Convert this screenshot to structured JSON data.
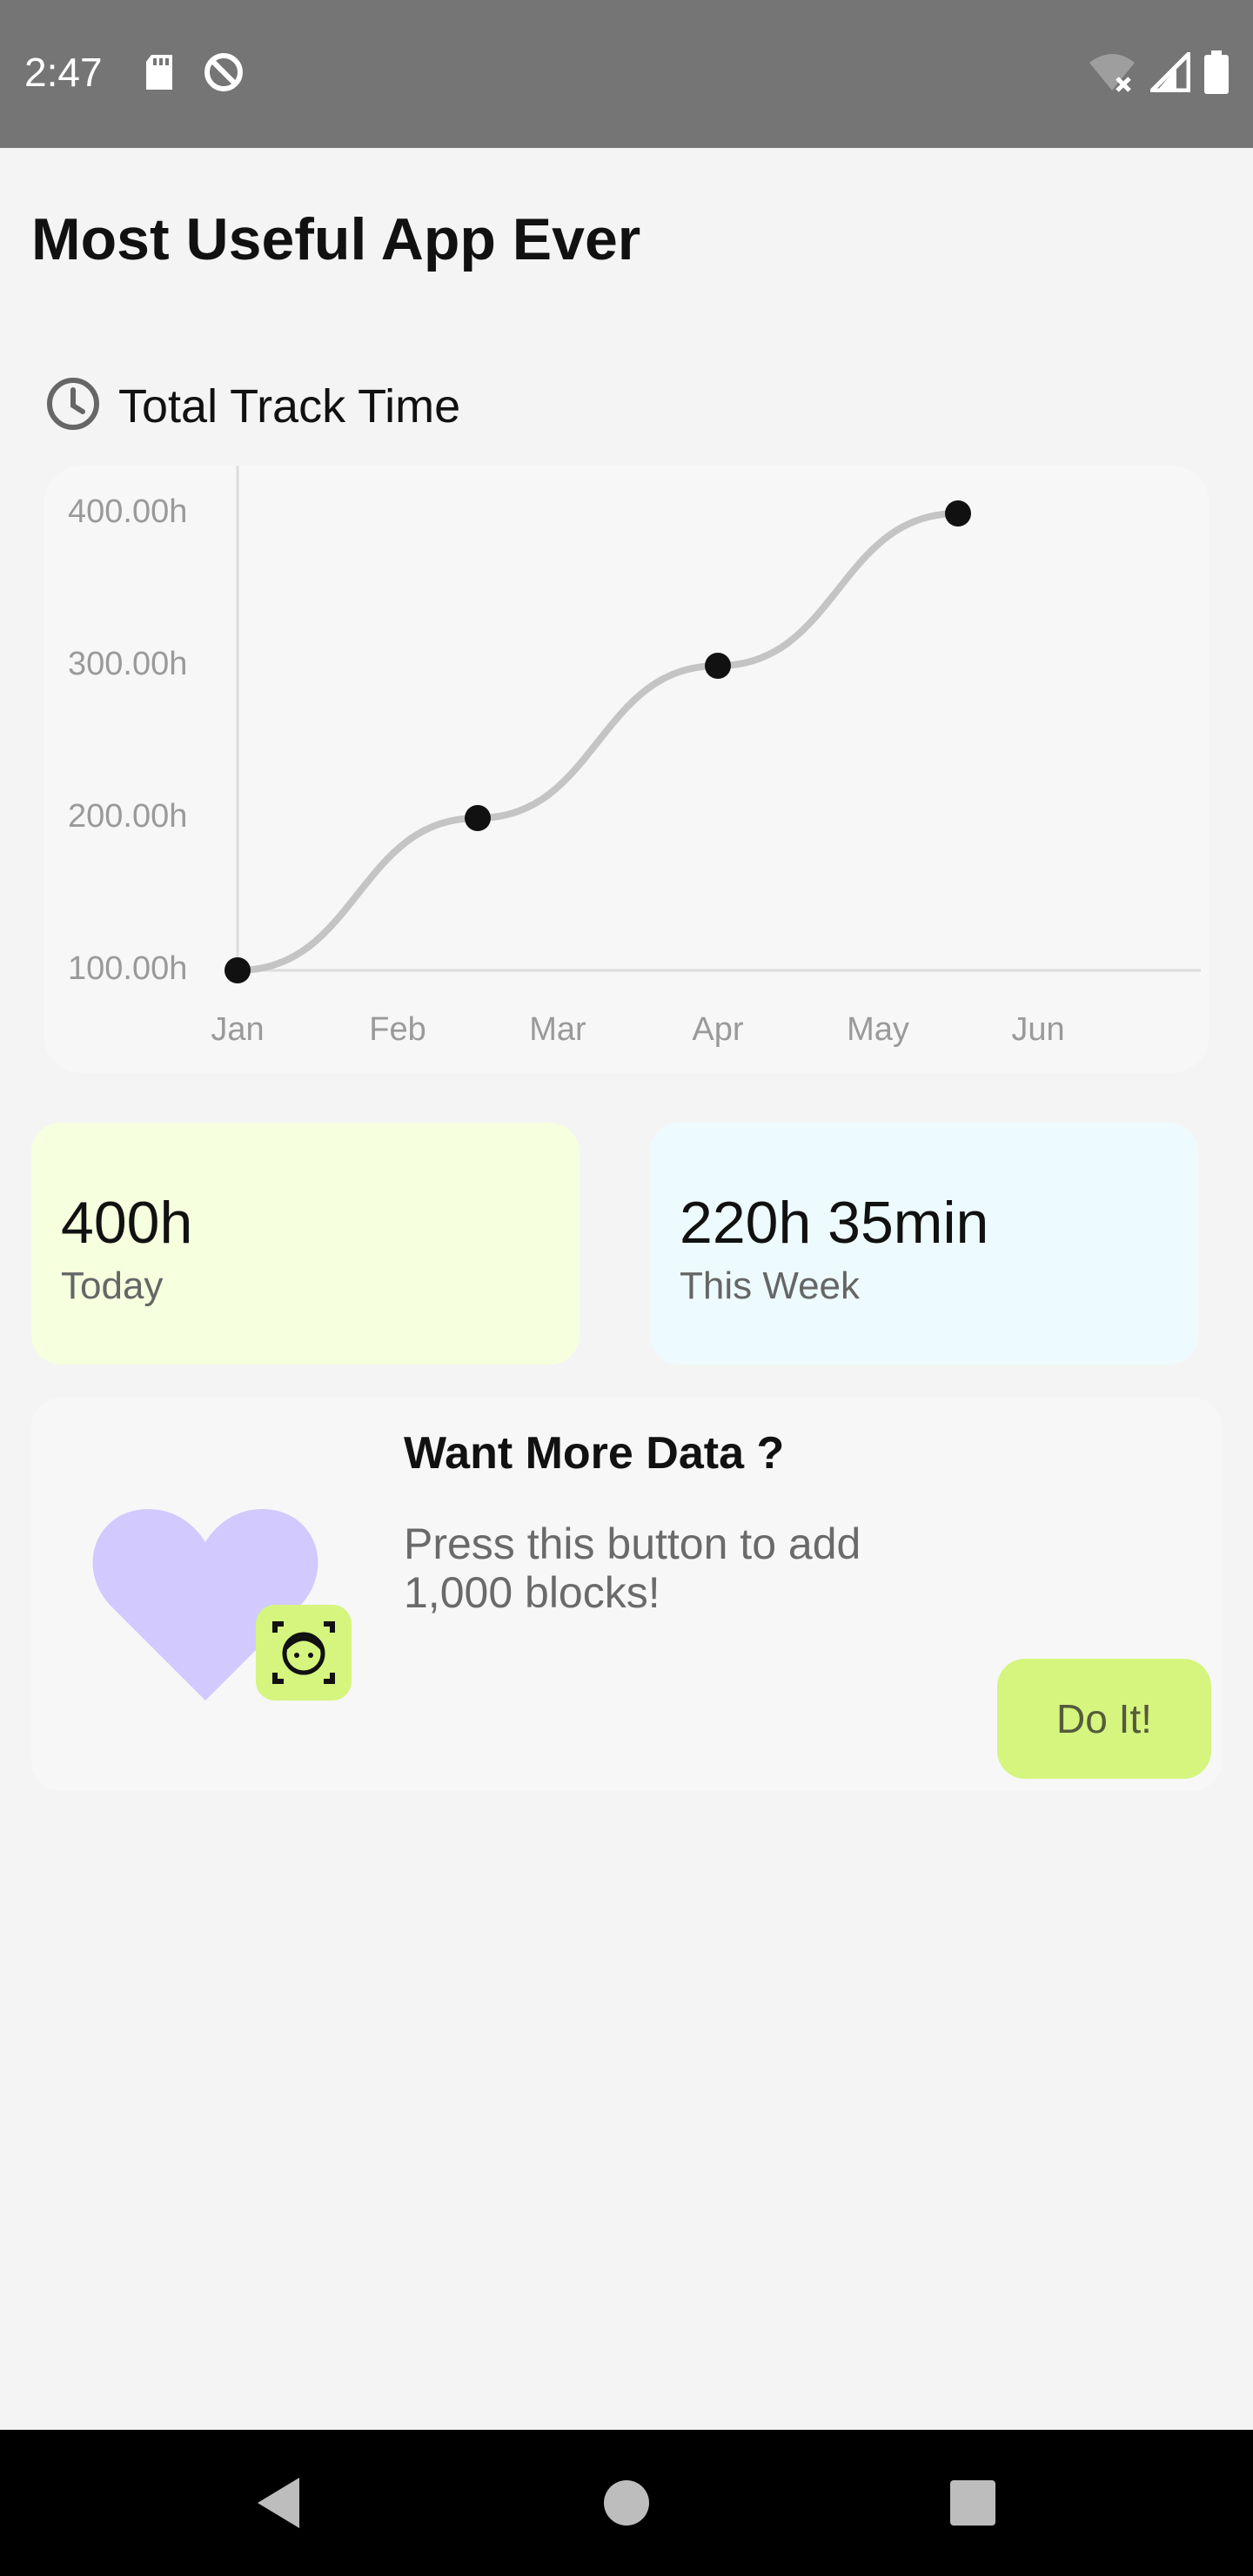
{
  "status_bar": {
    "time": "2:47",
    "left_icons": [
      "sd-card-icon",
      "data-saver-icon"
    ],
    "right_icons": [
      "wifi-off-icon",
      "cell-signal-icon",
      "battery-icon"
    ]
  },
  "app": {
    "title": "Most Useful App Ever"
  },
  "track_section": {
    "title": "Total Track Time",
    "icon": "clock-icon"
  },
  "chart_data": {
    "type": "line",
    "categories": [
      "Jan",
      "Feb",
      "Mar",
      "Apr",
      "May",
      "Jun"
    ],
    "x": [
      0,
      1.5,
      3,
      4.5
    ],
    "values": [
      100,
      200,
      300,
      400
    ],
    "y_ticks": [
      100,
      200,
      300,
      400
    ],
    "y_tick_labels": [
      "100.00h",
      "200.00h",
      "300.00h",
      "400.00h"
    ],
    "ylim": [
      100,
      430
    ],
    "smooth": true,
    "line_color": "#c4c4c4",
    "point_color": "#111111",
    "grid": false,
    "title": "",
    "xlabel": "",
    "ylabel": ""
  },
  "stats": [
    {
      "value": "400h",
      "label": "Today",
      "color": "#f6ffde"
    },
    {
      "value": "220h 35min",
      "label": "This Week",
      "color": "#eefbfe"
    }
  ],
  "promo": {
    "title": "Want More Data ?",
    "body": "Press this button to add 1,000 blocks!",
    "button_label": "Do It!",
    "icons": [
      "heart-icon",
      "face-scan-icon"
    ],
    "accent_color": "#d5f57f",
    "heart_color": "#d2c9ff"
  },
  "nav_bar": {
    "icons": [
      "back-icon",
      "home-icon",
      "recents-icon"
    ]
  }
}
